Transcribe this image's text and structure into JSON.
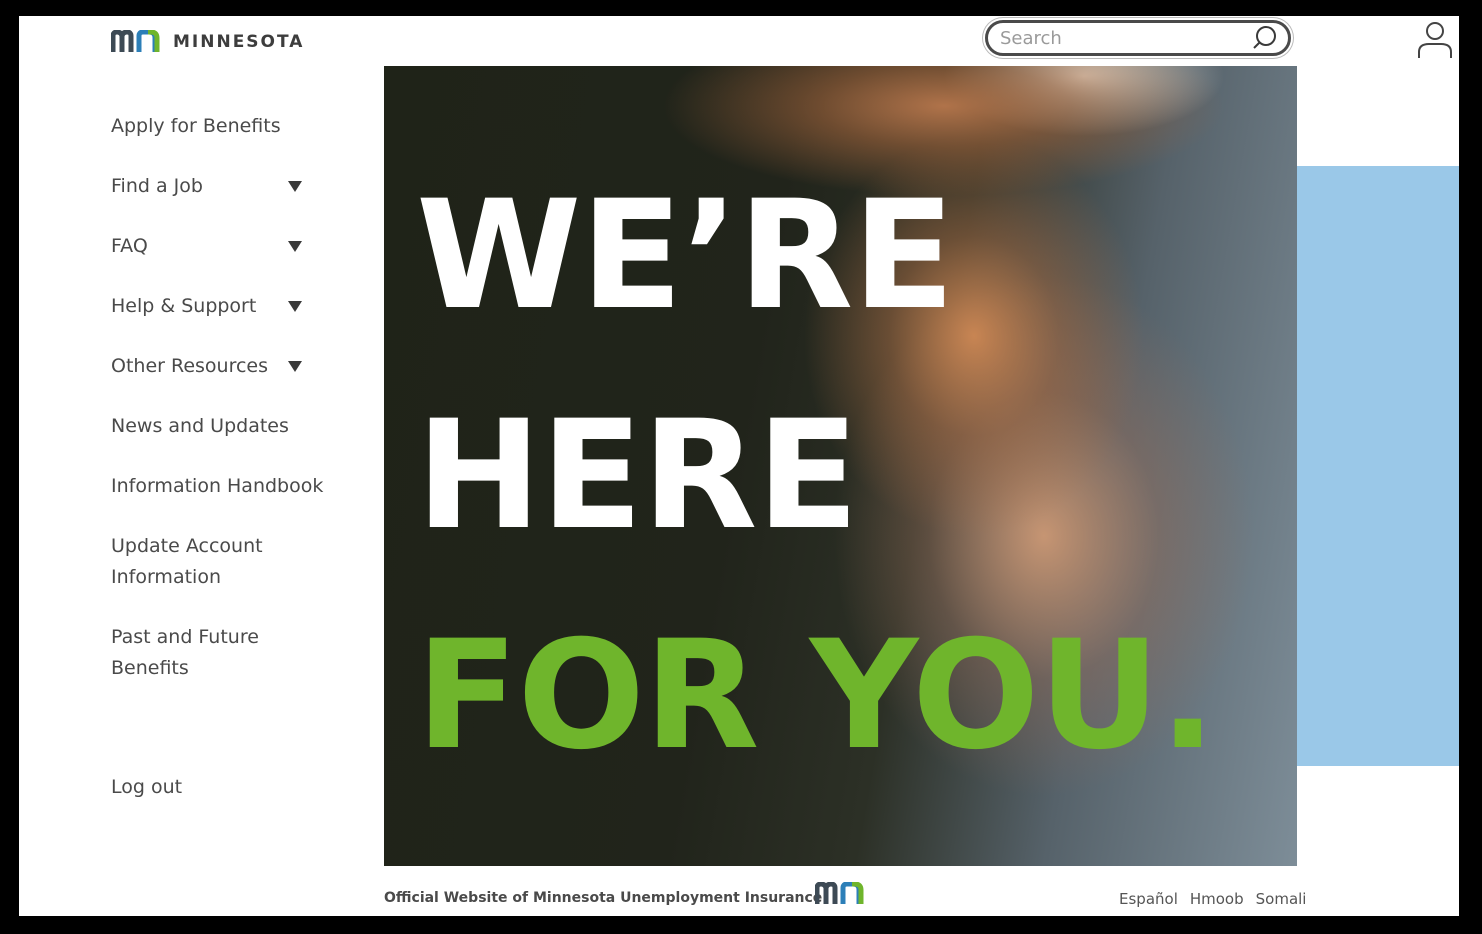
{
  "brand": {
    "name": "MINNESOTA",
    "colors": {
      "dark": "#3d3d3d",
      "accent_green": "#6fb52c",
      "accent_blue": "#9ac8e8"
    }
  },
  "search": {
    "placeholder": "Search",
    "icon": "search-icon"
  },
  "header": {
    "user_icon": "user-icon"
  },
  "sidebar": {
    "items": [
      {
        "label": "Apply for Benefits",
        "has_dropdown": false
      },
      {
        "label": "Find a Job",
        "has_dropdown": true
      },
      {
        "label": "FAQ",
        "has_dropdown": true
      },
      {
        "label": "Help & Support",
        "has_dropdown": true
      },
      {
        "label": "Other Resources",
        "has_dropdown": true
      },
      {
        "label": "News and Updates",
        "has_dropdown": false
      },
      {
        "label": "Information Handbook",
        "has_dropdown": false
      },
      {
        "label": "Update Account Information",
        "has_dropdown": false
      },
      {
        "label": "Past and Future Benefits",
        "has_dropdown": false
      }
    ],
    "logout": "Log out"
  },
  "hero": {
    "line1": "WE’RE",
    "line2": "HERE",
    "line3": "FOR YOU."
  },
  "footer": {
    "official": "Official Website of Minnesota Unemployment Insurance",
    "languages": [
      "Español",
      "Hmoob",
      "Somali"
    ]
  }
}
